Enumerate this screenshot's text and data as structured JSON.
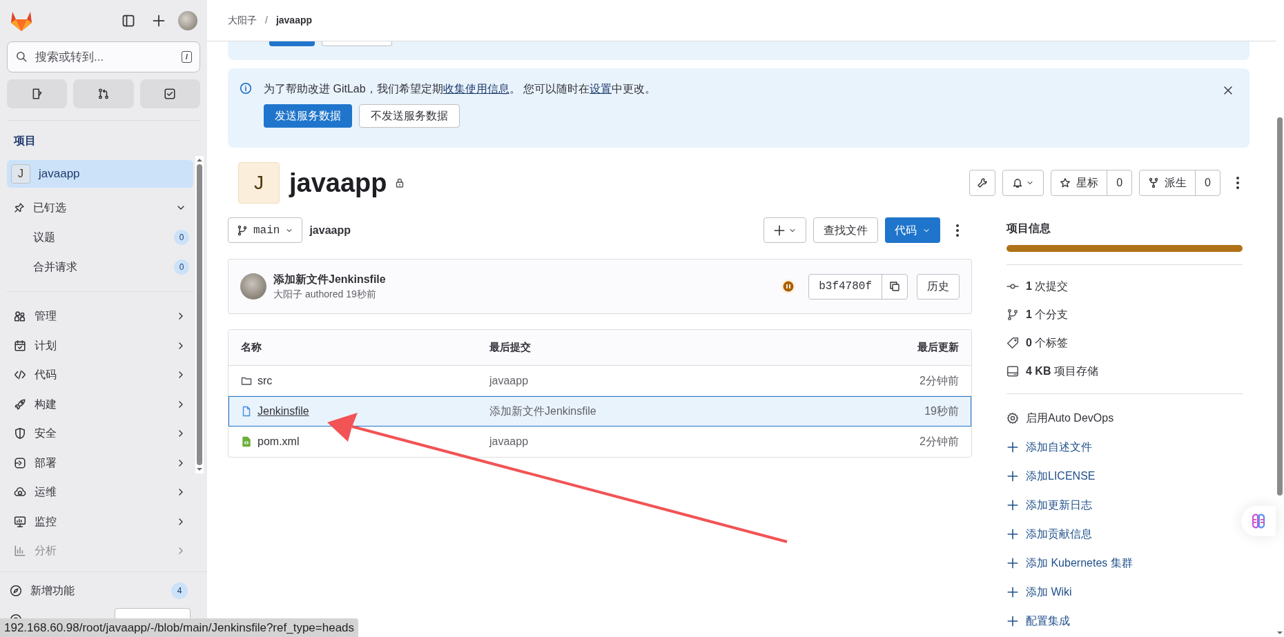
{
  "breadcrumb": {
    "items": [
      "大阳子",
      "javaapp"
    ],
    "separator": "/"
  },
  "sidebar": {
    "search": {
      "placeholder": "搜索或转到...",
      "shortcut": "/"
    },
    "section_title": "项目",
    "project": {
      "initial": "J",
      "name": "javaapp",
      "selected": true
    },
    "pinned": {
      "label": "已钉选",
      "expanded": true,
      "items": [
        {
          "label": "议题",
          "count": "0"
        },
        {
          "label": "合并请求",
          "count": "0"
        }
      ]
    },
    "nav_items": [
      {
        "label": "管理"
      },
      {
        "label": "计划"
      },
      {
        "label": "代码"
      },
      {
        "label": "构建"
      },
      {
        "label": "安全"
      },
      {
        "label": "部署"
      },
      {
        "label": "运维"
      },
      {
        "label": "监控"
      },
      {
        "label": "分析"
      }
    ],
    "whats_new": {
      "label": "新增功能",
      "count": "4"
    }
  },
  "status_url": "192.168.60.98/root/javaapp/-/blob/main/Jenkinsfile?ref_type=heads",
  "banner": {
    "parts": [
      {
        "text": "为了帮助改进 GitLab，我们希望定期",
        "link": false
      },
      {
        "text": "收集使用信息",
        "link": true
      },
      {
        "text": "。 您可以随时在",
        "link": false
      },
      {
        "text": "设置",
        "link": true
      },
      {
        "text": "中更改。",
        "link": false
      }
    ],
    "buttons": [
      {
        "label": "发送服务数据",
        "primary": true
      },
      {
        "label": "不发送服务数据",
        "primary": false
      }
    ]
  },
  "project": {
    "initial": "J",
    "name": "javaapp",
    "private": true,
    "star_label": "星标",
    "star_count": "0",
    "fork_label": "派生",
    "fork_count": "0"
  },
  "repo_toolbar": {
    "branch": "main",
    "path": "javaapp",
    "find_file": "查找文件",
    "code_button": "代码"
  },
  "last_commit": {
    "title": "添加新文件Jenkinsfile",
    "author": "大阳子",
    "meta": "authored 19秒前",
    "sha": "b3f4780f",
    "history": "历史"
  },
  "file_table": {
    "columns": [
      "名称",
      "最后提交",
      "最后更新"
    ],
    "rows": [
      {
        "kind": "folder",
        "name": "src",
        "commit": "javaapp",
        "updated": "2分钟前",
        "selected": false
      },
      {
        "kind": "file",
        "name": "Jenkinsfile",
        "commit": "添加新文件Jenkinsfile",
        "updated": "19秒前",
        "selected": true
      },
      {
        "kind": "xml",
        "name": "pom.xml",
        "commit": "javaapp",
        "updated": "2分钟前",
        "selected": false
      }
    ]
  },
  "project_info": {
    "title": "项目信息",
    "language_bar": [
      {
        "color": "#b07219",
        "level": 1
      }
    ],
    "stats": [
      {
        "value": "1",
        "label": "次提交"
      },
      {
        "value": "1",
        "label": "个分支"
      },
      {
        "value": "0",
        "label": "个标签"
      },
      {
        "value": "4 KB",
        "label": "项目存储"
      }
    ],
    "actions": [
      {
        "kind": "setting",
        "label": "启用Auto DevOps"
      },
      {
        "kind": "add",
        "label": "添加自述文件"
      },
      {
        "kind": "add",
        "label": "添加LICENSE"
      },
      {
        "kind": "add",
        "label": "添加更新日志"
      },
      {
        "kind": "add",
        "label": "添加贡献信息"
      },
      {
        "kind": "add",
        "label": "添加 Kubernetes 集群"
      },
      {
        "kind": "add",
        "label": "添加 Wiki"
      },
      {
        "kind": "add",
        "label": "配置集成"
      }
    ]
  }
}
